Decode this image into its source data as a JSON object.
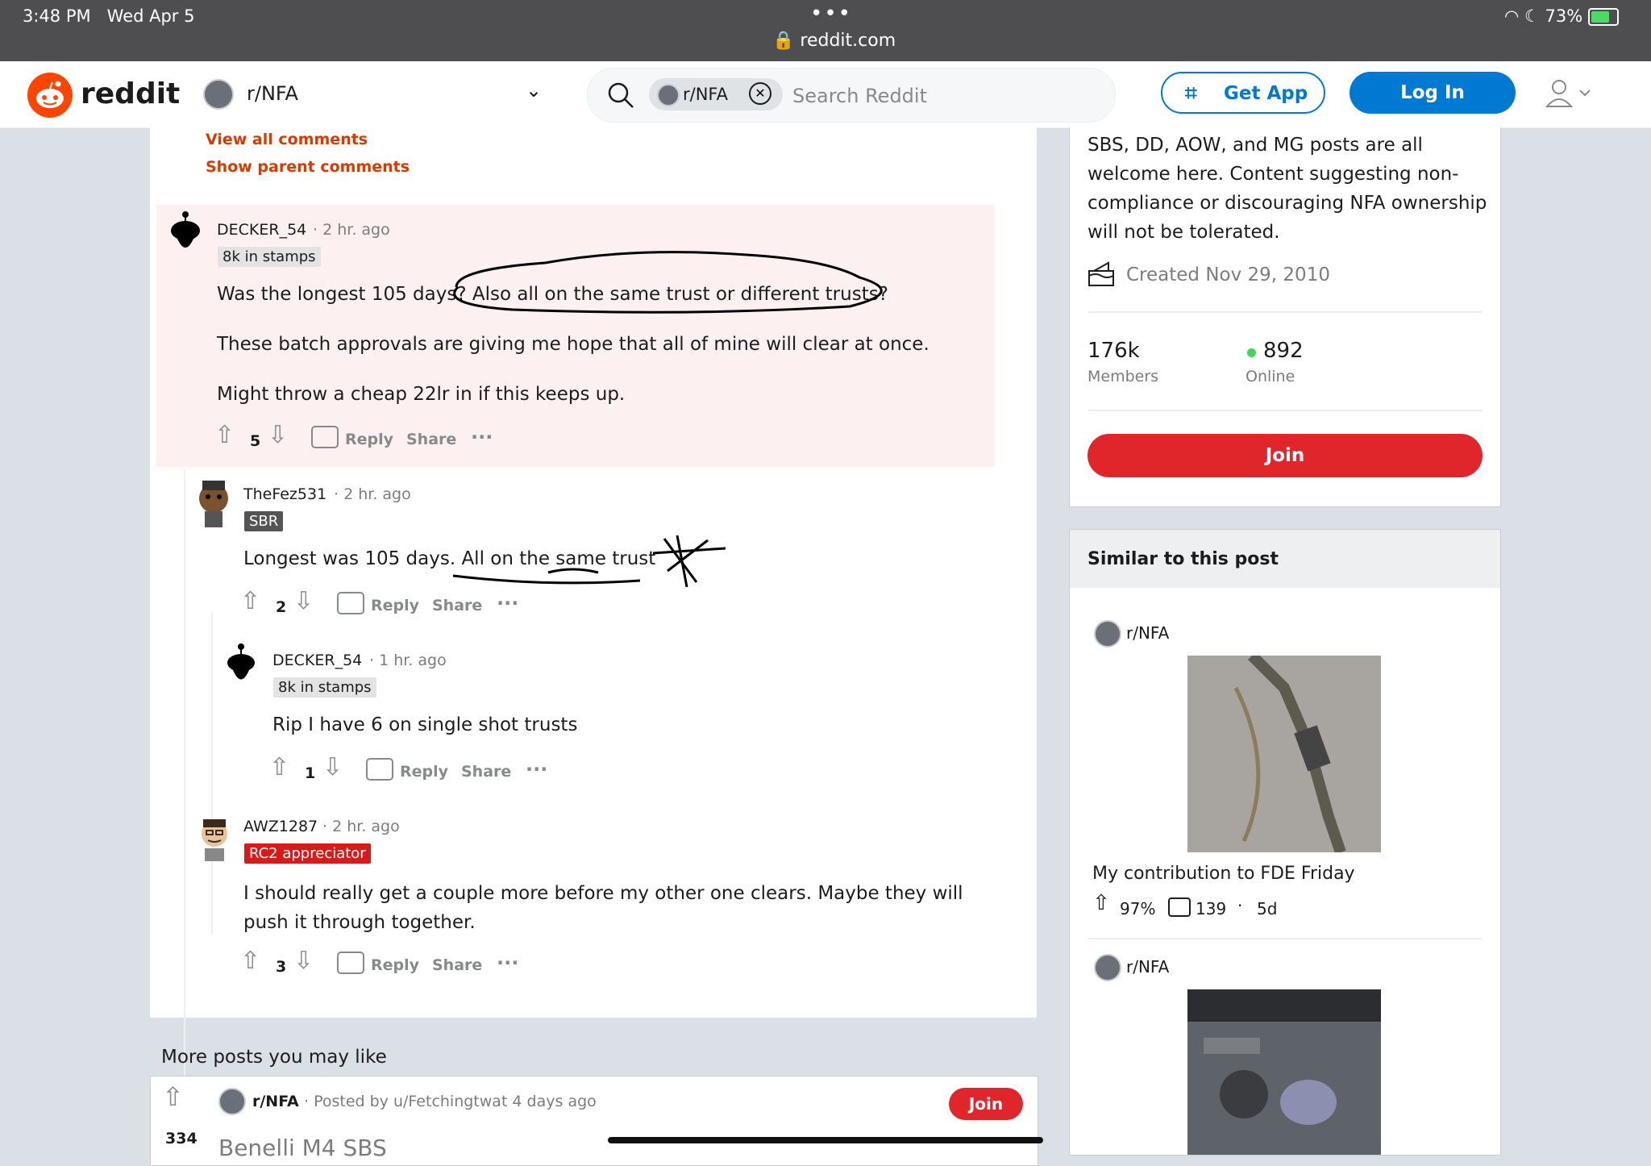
{
  "status_bar": {
    "time": "3:48 PM",
    "date": "Wed Apr 5",
    "url": "reddit.com",
    "battery": "73%"
  },
  "header": {
    "logo_text": "reddit",
    "community": "r/NFA",
    "search_chip": "r/NFA",
    "search_placeholder": "Search Reddit",
    "get_app": "Get App",
    "login": "Log In"
  },
  "thread": {
    "view_all": "View all comments",
    "show_parent": "Show parent comments",
    "comments": [
      {
        "user": "DECKER_54",
        "time": "· 2 hr. ago",
        "flair": "8k in stamps",
        "body": [
          "Was the longest 105 days? Also all on the same trust or different trusts?",
          "These batch approvals are giving me hope that all of mine will clear at once.",
          "Might throw a cheap 22lr in if this keeps up."
        ],
        "votes": "5"
      },
      {
        "user": "TheFez531",
        "time": "· 2 hr. ago",
        "flair": "SBR",
        "body": [
          "Longest was 105 days. All on the same trust"
        ],
        "votes": "2"
      },
      {
        "user": "DECKER_54",
        "time": "· 1 hr. ago",
        "flair": "8k in stamps",
        "body": [
          "Rip I have 6 on single shot trusts"
        ],
        "votes": "1"
      },
      {
        "user": "AWZ1287",
        "time": "· 2 hr. ago",
        "flair": "RC2 appreciator",
        "body": [
          "I should really get a couple more before my other one clears. Maybe they will push it through together."
        ],
        "votes": "3"
      }
    ],
    "reply_label": "Reply",
    "share_label": "Share",
    "more_label": "···"
  },
  "about": {
    "description": "SBS, DD, AOW, and MG posts are all welcome here. Content suggesting non-compliance or discouraging NFA ownership will not be tolerated.",
    "created": "Created Nov 29, 2010",
    "members_count": "176k",
    "members_label": "Members",
    "online_count": "892",
    "online_label": "Online",
    "join": "Join"
  },
  "similar": {
    "heading": "Similar to this post",
    "posts": [
      {
        "community": "r/NFA",
        "title": "My contribution to FDE Friday",
        "upvote_pct": "97%",
        "comments": "139",
        "age": "5d"
      },
      {
        "community": "r/NFA"
      }
    ]
  },
  "more_posts": {
    "heading": "More posts you may like",
    "post": {
      "votes": "334",
      "community": "r/NFA",
      "posted_by": "· Posted by u/Fetchingtwat 4 days ago",
      "title": "Benelli M4 SBS",
      "join": "Join"
    }
  },
  "colors": {
    "brand": "#ff4500",
    "link_blue": "#0079d3",
    "join_red": "#e0262a",
    "online_green": "#46d160"
  }
}
